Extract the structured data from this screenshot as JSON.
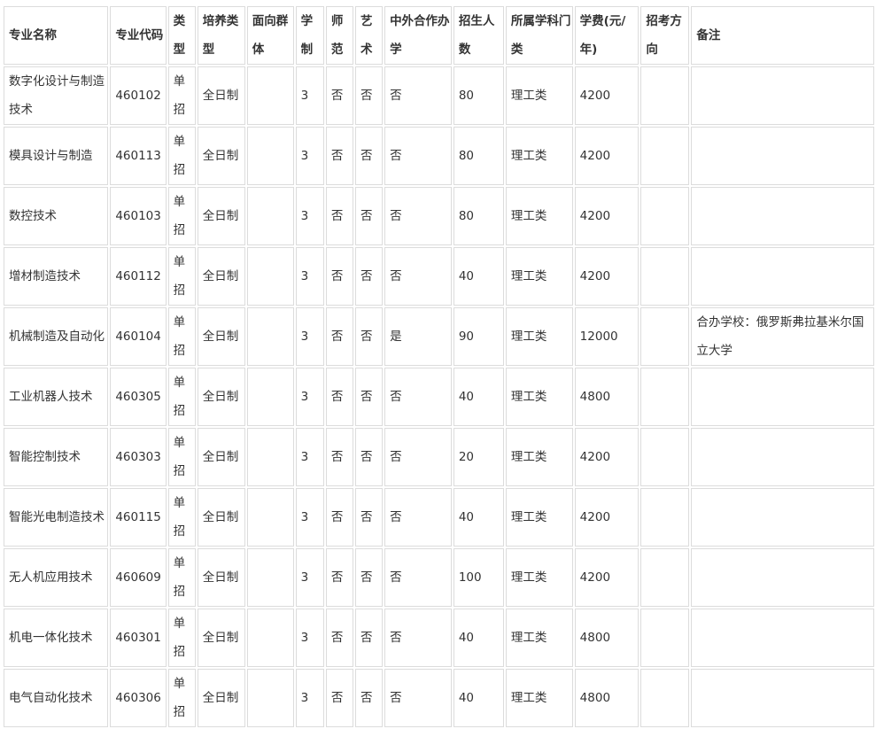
{
  "table": {
    "headers": [
      "专业名称",
      "专业代码",
      "类型",
      "培养类型",
      "面向群体",
      "学制",
      "师范",
      "艺术",
      "中外合作办学",
      "招生人数",
      "所属学科门类",
      "学费(元/年)",
      "招考方向",
      "备注"
    ],
    "rows": [
      [
        "数字化设计与制造技术",
        "460102",
        "单招",
        "全日制",
        "",
        "3",
        "否",
        "否",
        "否",
        "80",
        "理工类",
        "4200",
        "",
        ""
      ],
      [
        "模具设计与制造",
        "460113",
        "单招",
        "全日制",
        "",
        "3",
        "否",
        "否",
        "否",
        "80",
        "理工类",
        "4200",
        "",
        ""
      ],
      [
        "数控技术",
        "460103",
        "单招",
        "全日制",
        "",
        "3",
        "否",
        "否",
        "否",
        "80",
        "理工类",
        "4200",
        "",
        ""
      ],
      [
        "增材制造技术",
        "460112",
        "单招",
        "全日制",
        "",
        "3",
        "否",
        "否",
        "否",
        "40",
        "理工类",
        "4200",
        "",
        ""
      ],
      [
        "机械制造及自动化",
        "460104",
        "单招",
        "全日制",
        "",
        "3",
        "否",
        "否",
        "是",
        "90",
        "理工类",
        "12000",
        "",
        "合办学校：俄罗斯弗拉基米尔国立大学"
      ],
      [
        "工业机器人技术",
        "460305",
        "单招",
        "全日制",
        "",
        "3",
        "否",
        "否",
        "否",
        "40",
        "理工类",
        "4800",
        "",
        ""
      ],
      [
        "智能控制技术",
        "460303",
        "单招",
        "全日制",
        "",
        "3",
        "否",
        "否",
        "否",
        "20",
        "理工类",
        "4200",
        "",
        ""
      ],
      [
        "智能光电制造技术",
        "460115",
        "单招",
        "全日制",
        "",
        "3",
        "否",
        "否",
        "否",
        "40",
        "理工类",
        "4200",
        "",
        ""
      ],
      [
        "无人机应用技术",
        "460609",
        "单招",
        "全日制",
        "",
        "3",
        "否",
        "否",
        "否",
        "100",
        "理工类",
        "4200",
        "",
        ""
      ],
      [
        "机电一体化技术",
        "460301",
        "单招",
        "全日制",
        "",
        "3",
        "否",
        "否",
        "否",
        "40",
        "理工类",
        "4800",
        "",
        ""
      ],
      [
        "电气自动化技术",
        "460306",
        "单招",
        "全日制",
        "",
        "3",
        "否",
        "否",
        "否",
        "40",
        "理工类",
        "4800",
        "",
        ""
      ]
    ]
  }
}
